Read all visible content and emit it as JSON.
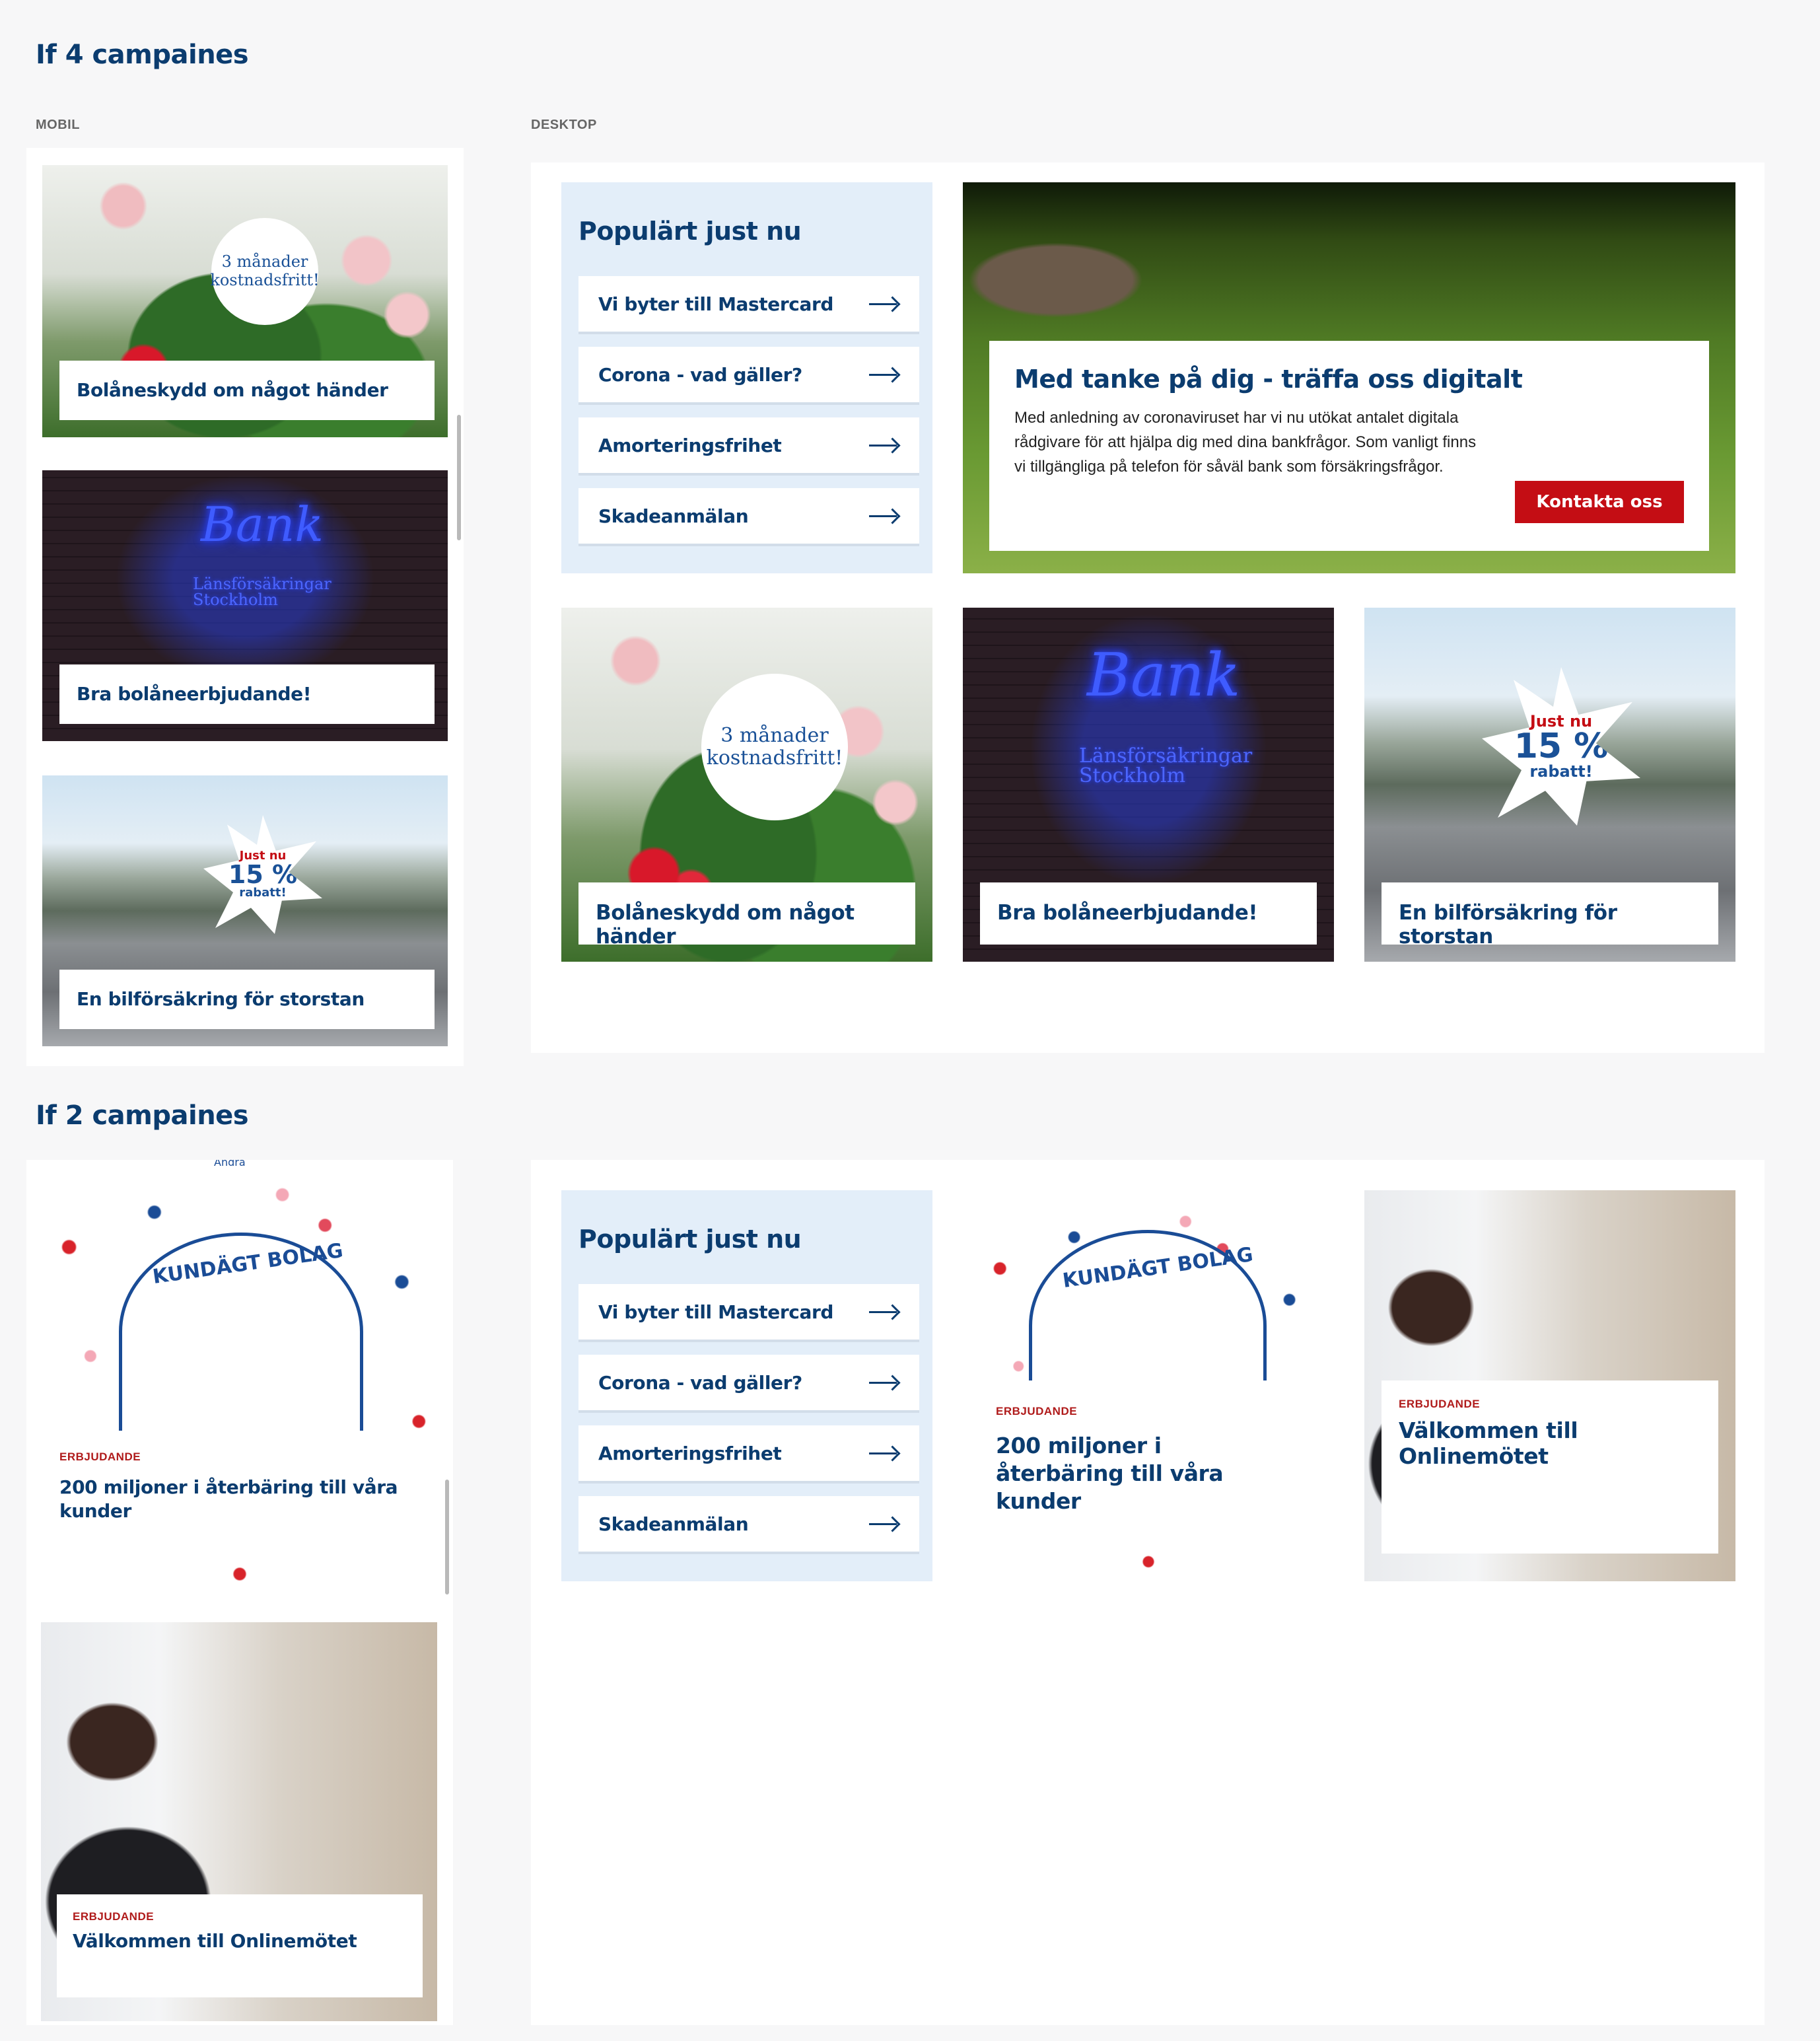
{
  "section1": {
    "title": "If 4 campaines"
  },
  "section2": {
    "title": "If 2 campaines"
  },
  "labels": {
    "mobile": "MOBIL",
    "desktop": "DESKTOP"
  },
  "popular": {
    "title": "Populärt just nu",
    "items": [
      "Vi byter till Mastercard",
      "Corona - vad gäller?",
      "Amorteringsfrihet",
      "Skadeanmälan"
    ]
  },
  "campaigns": {
    "bolaneskydd": {
      "label": "Bolåneskydd om något händer",
      "badge_line1": "3 månader",
      "badge_line2": "kostnadsfritt!"
    },
    "bank": {
      "label": "Bra bolåneerbjudande!",
      "neon": "Bank",
      "neon_sub1": "Länsförsäkringar",
      "neon_sub2": "Stockholm"
    },
    "bil": {
      "label": "En bilförsäkring för storstan",
      "star_line1": "Just nu",
      "star_line2": "15 %",
      "star_line3": "rabatt!"
    },
    "hero": {
      "title": "Med tanke på dig - träffa oss digitalt",
      "body": "Med anledning av coronaviruset har vi nu utökat antalet digitala rådgivare för att hjälpa dig med dina bankfrågor. Som vanligt finns vi tillgängliga på telefon för såväl bank som försäkringsfrågor.",
      "button": "Kontakta oss"
    },
    "aterbaring": {
      "tag": "ERBJUDANDE",
      "label": "200 miljoner i återbäring till våra kunder",
      "emblem_text": "KUNDÄGT BOLAG",
      "emblem_top": "Andra"
    },
    "onlinemote": {
      "tag": "ERBJUDANDE",
      "label": "Välkommen till Onlinemötet"
    }
  },
  "colors": {
    "brand_navy": "#0b3c6f",
    "accent_red": "#c40d14",
    "popular_bg": "#e3eef9",
    "tag_red": "#b01b1b"
  }
}
